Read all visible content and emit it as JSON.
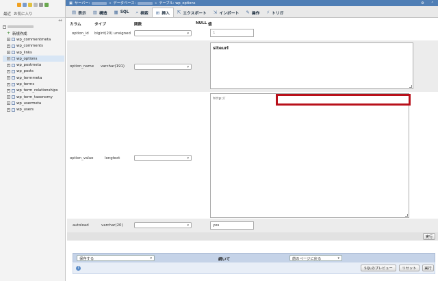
{
  "nav": {
    "tabs": [
      "最近",
      "お気に入り"
    ],
    "new_label": "新規作成",
    "tables": [
      "wp_commentmeta",
      "wp_comments",
      "wp_links",
      "wp_options",
      "wp_postmeta",
      "wp_posts",
      "wp_termmeta",
      "wp_terms",
      "wp_term_relationships",
      "wp_term_taxonomy",
      "wp_usermeta",
      "wp_users"
    ],
    "selected_table": "wp_options"
  },
  "breadcrumb": {
    "server": "サーバー:",
    "database": "データベース:",
    "table": "テーブル: wp_options"
  },
  "tabs": [
    {
      "label": "表示",
      "icon": "browse-icon"
    },
    {
      "label": "構造",
      "icon": "structure-icon"
    },
    {
      "label": "SQL",
      "icon": "sql-icon"
    },
    {
      "label": "検索",
      "icon": "search-icon"
    },
    {
      "label": "挿入",
      "icon": "insert-icon",
      "active": true
    },
    {
      "label": "エクスポート",
      "icon": "export-icon"
    },
    {
      "label": "インポート",
      "icon": "import-icon"
    },
    {
      "label": "操作",
      "icon": "operations-icon"
    },
    {
      "label": "トリガ",
      "icon": "triggers-icon"
    }
  ],
  "headers": {
    "column": "カラム",
    "type": "タイプ",
    "function": "関数",
    "null": "NULL",
    "value": "値"
  },
  "rows": [
    {
      "name": "option_id",
      "type": "bigint(20) unsigned",
      "value": "1"
    },
    {
      "name": "option_name",
      "type": "varchar(191)",
      "value": "siteurl"
    },
    {
      "name": "option_value",
      "type": "longtext",
      "value": "http://"
    },
    {
      "name": "autoload",
      "type": "varchar(20)",
      "value": "yes"
    }
  ],
  "execute_label": "実行",
  "bottom": {
    "save_select": "保存する",
    "and_then": "続いて",
    "after_select": "前のページに戻る",
    "preview_sql": "SQLのプレビュー",
    "reset": "リセット",
    "go": "実行"
  }
}
